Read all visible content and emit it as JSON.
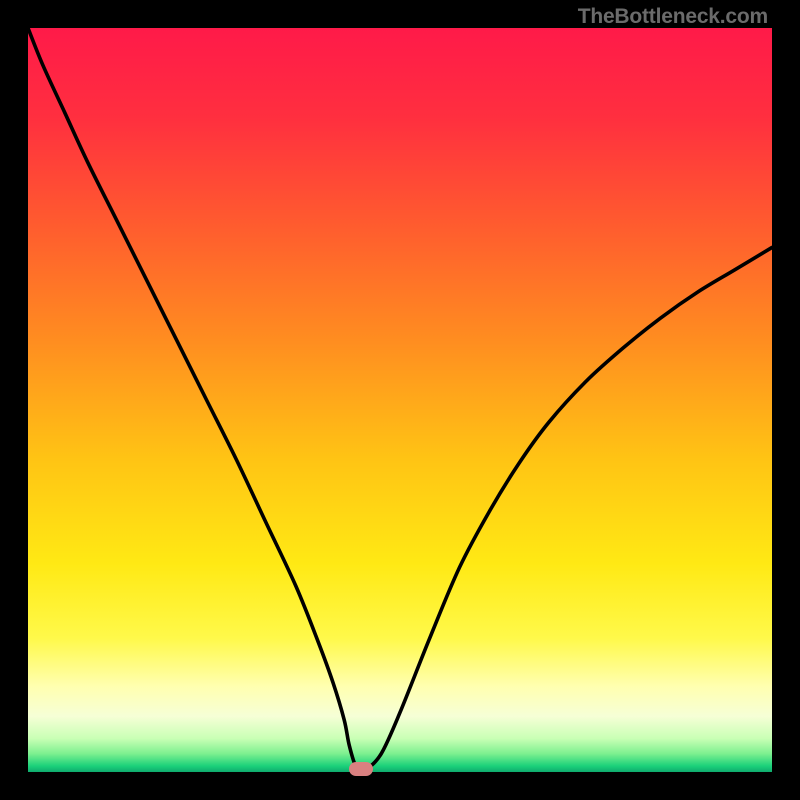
{
  "watermark": "TheBottleneck.com",
  "gradient": {
    "stops": [
      {
        "offset": 0.0,
        "color": "#ff1a49"
      },
      {
        "offset": 0.12,
        "color": "#ff2f3f"
      },
      {
        "offset": 0.26,
        "color": "#ff5a2f"
      },
      {
        "offset": 0.42,
        "color": "#ff8d20"
      },
      {
        "offset": 0.58,
        "color": "#ffc414"
      },
      {
        "offset": 0.72,
        "color": "#ffe914"
      },
      {
        "offset": 0.82,
        "color": "#fff94a"
      },
      {
        "offset": 0.885,
        "color": "#ffffb0"
      },
      {
        "offset": 0.925,
        "color": "#f6ffd6"
      },
      {
        "offset": 0.955,
        "color": "#c9ffb5"
      },
      {
        "offset": 0.975,
        "color": "#7ff090"
      },
      {
        "offset": 0.992,
        "color": "#1bd17a"
      },
      {
        "offset": 1.0,
        "color": "#0fab6e"
      }
    ]
  },
  "chart_data": {
    "type": "line",
    "title": "",
    "xlabel": "",
    "ylabel": "",
    "xlim": [
      0,
      100
    ],
    "ylim": [
      0,
      100
    ],
    "grid": false,
    "legend": false,
    "series": [
      {
        "name": "bottleneck-curve",
        "x": [
          0,
          2,
          5,
          8,
          12,
          16,
          20,
          24,
          28,
          32,
          36,
          39,
          41,
          42.5,
          43.2,
          44.2,
          45.5,
          47.5,
          50,
          54,
          58,
          62,
          66,
          70,
          75,
          80,
          85,
          90,
          95,
          100
        ],
        "y": [
          100,
          95,
          88.5,
          82,
          74,
          66,
          58,
          50,
          42,
          33.5,
          25,
          17.5,
          12,
          7,
          3.5,
          0.5,
          0.4,
          2.5,
          8,
          18,
          27.5,
          35,
          41.5,
          47,
          52.5,
          57,
          61,
          64.5,
          67.5,
          70.5
        ]
      }
    ],
    "marker": {
      "x": 44.7,
      "y": 0.4
    }
  }
}
